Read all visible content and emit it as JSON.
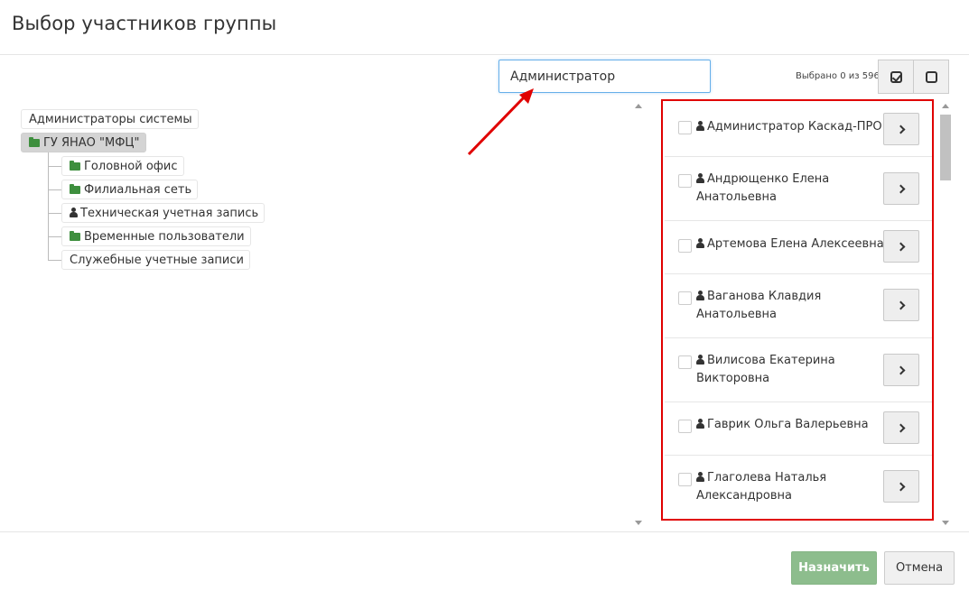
{
  "dialog": {
    "title": "Выбор участников группы"
  },
  "search": {
    "value": "Администратор"
  },
  "selection": {
    "counter": "Выбрано 0 из 596"
  },
  "tree": {
    "items": [
      {
        "label": "Администраторы системы",
        "icon": "none"
      },
      {
        "label": "ГУ ЯНАО \"МФЦ\"",
        "icon": "folder-open-icon",
        "selected": true
      },
      {
        "label": "Головной офис",
        "icon": "folder-icon"
      },
      {
        "label": "Филиальная сеть",
        "icon": "folder-icon"
      },
      {
        "label": "Техническая учетная запись",
        "icon": "user-icon"
      },
      {
        "label": "Временные пользователи",
        "icon": "folder-icon"
      },
      {
        "label": "Служебные учетные записи",
        "icon": "none"
      }
    ]
  },
  "users": [
    {
      "line1": "Администратор Каскад-ПРО",
      "line2": ""
    },
    {
      "line1": "Андрющенко Елена",
      "line2": "Анатольевна"
    },
    {
      "line1": "Артемова Елена Алексеевна",
      "line2": ""
    },
    {
      "line1": "Ваганова Клавдия",
      "line2": "Анатольевна"
    },
    {
      "line1": "Вилисова Екатерина",
      "line2": "Викторовна"
    },
    {
      "line1": "Гаврик Ольга Валерьевна",
      "line2": ""
    },
    {
      "line1": "Глаголева Наталья",
      "line2": "Александровна"
    }
  ],
  "footer": {
    "assign_label": "Назначить",
    "cancel_label": "Отмена"
  },
  "colors": {
    "highlight": "#e00000",
    "assign": "#8dbd8d",
    "folder": "#3e8f3e"
  }
}
